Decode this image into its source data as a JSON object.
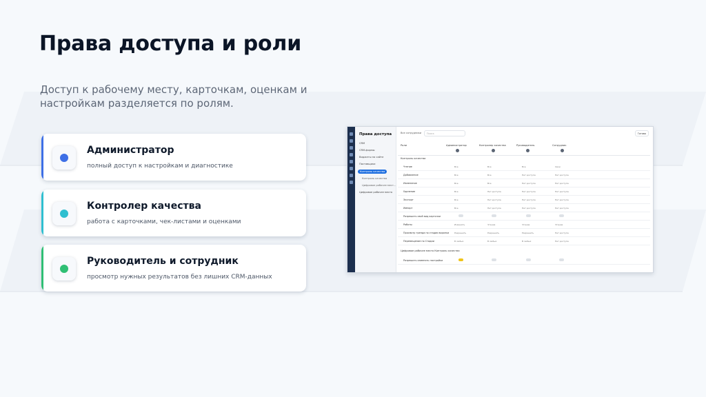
{
  "slide": {
    "title": "Права доступа и роли",
    "subtitle": "Доступ к рабочему месту, карточкам, оценкам и настройкам разделяется по ролям."
  },
  "roles": [
    {
      "title": "Администратор",
      "description": "полный доступ к настройкам и диагностике",
      "color": "#3d6fe6"
    },
    {
      "title": "Контролер качества",
      "description": "работа с карточками, чек-листами и оценками",
      "color": "#2fbfd0"
    },
    {
      "title": "Руководитель и сотрудник",
      "description": "просмотр нужных результатов без лишних CRM-данных",
      "color": "#2fbf74"
    }
  ],
  "screenshot": {
    "page_title": "Права доступа",
    "sidebar": [
      "CRM",
      "CRM-формы",
      "Виджеты на сайте",
      "Поставщики",
      "Контроль качества",
      "Контроль качества",
      "Цифровое рабочее мест…",
      "Цифровое рабочее место"
    ],
    "role_selector": "Все сотрудники",
    "search_placeholder": "Поиск",
    "action_button": "Готово",
    "roles_label": "Роли",
    "columns": [
      "Администратор",
      "Контролер качества",
      "Руководитель",
      "Сотрудник"
    ],
    "group_quality": "Контроль качества",
    "group_digital": "Цифровое рабочее место Контроль качества",
    "rows": [
      {
        "label": "Чтение",
        "values": [
          "Все",
          "Все",
          "Все",
          "Свои"
        ]
      },
      {
        "label": "Добавление",
        "values": [
          "Все",
          "Все",
          "Нет доступа",
          "Нет доступа"
        ]
      },
      {
        "label": "Изменение",
        "values": [
          "Все",
          "Все",
          "Нет доступа",
          "Нет доступа"
        ]
      },
      {
        "label": "Удаление",
        "values": [
          "Все",
          "Нет доступа",
          "Нет доступа",
          "Нет доступа"
        ]
      },
      {
        "label": "Экспорт",
        "values": [
          "Все",
          "Нет доступа",
          "Нет доступа",
          "Нет доступа"
        ]
      },
      {
        "label": "Импорт",
        "values": [
          "Все",
          "Нет доступа",
          "Нет доступа",
          "Нет доступа"
        ]
      },
      {
        "label": "Разрешить свой вид карточки",
        "values": [
          "",
          "",
          "",
          ""
        ]
      },
      {
        "label": "Работы",
        "values": [
          "Изменять",
          "Чтение",
          "Чтение",
          "Чтение"
        ]
      },
      {
        "label": "Просмотр тренда по стадии воронки",
        "values": [
          "Разрешить",
          "Разрешить",
          "Разрешить",
          "Нет доступа"
        ]
      },
      {
        "label": "Перемещение по Стадии",
        "values": [
          "В любых",
          "В любых",
          "В любых",
          "Нет доступа"
        ]
      }
    ],
    "digital_row": "Разрешить изменять настройки"
  }
}
